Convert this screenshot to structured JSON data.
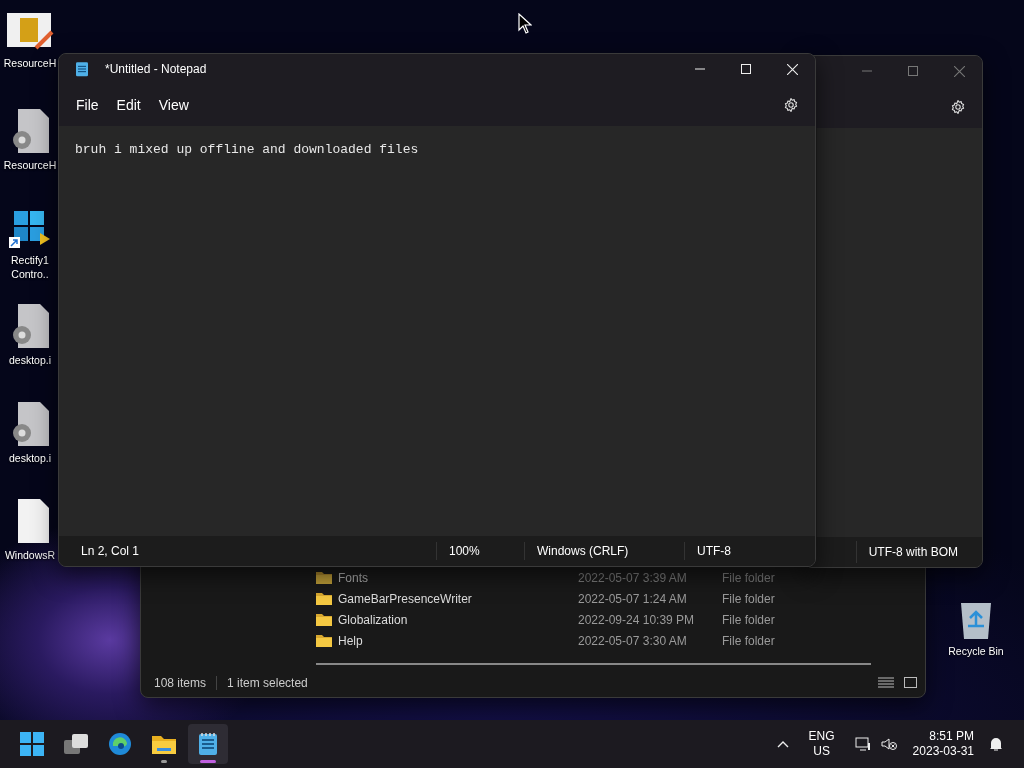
{
  "desktop_icons": [
    {
      "kind": "editor",
      "label": "ResourceH"
    },
    {
      "kind": "settings-file",
      "label": "ResourceH"
    },
    {
      "kind": "shortcut",
      "label": "Rectify1 Contro.."
    },
    {
      "kind": "settings-file",
      "label": "desktop.i"
    },
    {
      "kind": "settings-file",
      "label": "desktop.i"
    },
    {
      "kind": "blank-file",
      "label": "WindowsR"
    }
  ],
  "recycle_bin": {
    "label": "Recycle Bin"
  },
  "background_notepad": {
    "status_bar": {
      "encoding": "UTF-8 with BOM"
    }
  },
  "explorer": {
    "rows": [
      {
        "name": "Fonts",
        "date": "2022-05-07 3:39 AM",
        "type": "File folder"
      },
      {
        "name": "GameBarPresenceWriter",
        "date": "2022-05-07 1:24 AM",
        "type": "File folder"
      },
      {
        "name": "Globalization",
        "date": "2022-09-24 10:39 PM",
        "type": "File folder"
      },
      {
        "name": "Help",
        "date": "2022-05-07 3:30 AM",
        "type": "File folder"
      }
    ],
    "status_bar": {
      "item_count": "108 items",
      "selection": "1 item selected"
    }
  },
  "notepad": {
    "title": "*Untitled - Notepad",
    "menu": [
      "File",
      "Edit",
      "View"
    ],
    "text": "bruh i mixed up offline and downloaded files",
    "status_bar": {
      "position": "Ln 2, Col 1",
      "zoom": "100%",
      "line_ending": "Windows (CRLF)",
      "encoding": "UTF-8"
    }
  },
  "taskbar": {
    "apps": [
      {
        "kind": "start",
        "running": false,
        "selected": false
      },
      {
        "kind": "task-view",
        "running": false,
        "selected": false
      },
      {
        "kind": "browser",
        "running": false,
        "selected": false
      },
      {
        "kind": "explorer",
        "running": true,
        "selected": false
      },
      {
        "kind": "notepad",
        "running": true,
        "selected": true
      }
    ],
    "language": "ENG",
    "region": "US",
    "time": "8:51 PM",
    "date": "2023-03-31"
  }
}
